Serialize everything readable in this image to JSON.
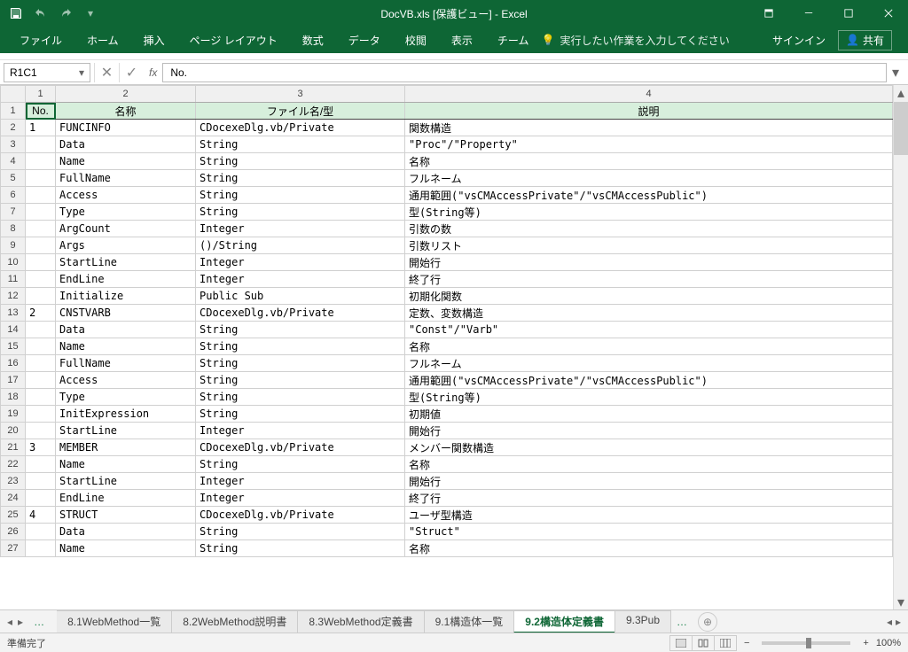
{
  "title": "DocVB.xls [保護ビュー] - Excel",
  "qat": {
    "save": "save",
    "undo": "undo",
    "redo": "redo"
  },
  "ribbon": {
    "tabs": [
      "ファイル",
      "ホーム",
      "挿入",
      "ページ レイアウト",
      "数式",
      "データ",
      "校閲",
      "表示",
      "チーム"
    ],
    "tell_me": "実行したい作業を入力してください",
    "signin": "サインイン",
    "share": "共有"
  },
  "formula_bar": {
    "name_box": "R1C1",
    "formula": "No."
  },
  "columns": {
    "numbers": [
      "1",
      "2",
      "3",
      "4"
    ]
  },
  "header_row": [
    "No.",
    "名称",
    "ファイル名/型",
    "説明"
  ],
  "rows": [
    {
      "r": 1,
      "h": true
    },
    {
      "r": 2,
      "no": "1",
      "name": "FUNCINFO",
      "file": "CDocexeDlg.vb/Private",
      "desc": "関数構造",
      "top": true
    },
    {
      "r": 3,
      "name": "Data",
      "file": "String",
      "desc": "\"Proc\"/\"Property\""
    },
    {
      "r": 4,
      "name": "Name",
      "file": "String",
      "desc": "名称"
    },
    {
      "r": 5,
      "name": "FullName",
      "file": "String",
      "desc": "フルネーム"
    },
    {
      "r": 6,
      "name": "Access",
      "file": "String",
      "desc": "通用範囲(\"vsCMAccessPrivate\"/\"vsCMAccessPublic\")"
    },
    {
      "r": 7,
      "name": "Type",
      "file": "String",
      "desc": "型(String等)"
    },
    {
      "r": 8,
      "name": "ArgCount",
      "file": "Integer",
      "desc": "引数の数"
    },
    {
      "r": 9,
      "name": "Args",
      "file": "()/String",
      "desc": "引数リスト"
    },
    {
      "r": 10,
      "name": "StartLine",
      "file": "Integer",
      "desc": "開始行"
    },
    {
      "r": 11,
      "name": "EndLine",
      "file": "Integer",
      "desc": "終了行"
    },
    {
      "r": 12,
      "name": "Initialize",
      "file": "Public Sub",
      "desc": "初期化関数"
    },
    {
      "r": 13,
      "no": "2",
      "name": "CNSTVARB",
      "file": "CDocexeDlg.vb/Private",
      "desc": "定数、変数構造",
      "top": true
    },
    {
      "r": 14,
      "name": "Data",
      "file": "String",
      "desc": "\"Const\"/\"Varb\""
    },
    {
      "r": 15,
      "name": "Name",
      "file": "String",
      "desc": "名称"
    },
    {
      "r": 16,
      "name": "FullName",
      "file": "String",
      "desc": "フルネーム"
    },
    {
      "r": 17,
      "name": "Access",
      "file": "String",
      "desc": "通用範囲(\"vsCMAccessPrivate\"/\"vsCMAccessPublic\")"
    },
    {
      "r": 18,
      "name": "Type",
      "file": "String",
      "desc": "型(String等)"
    },
    {
      "r": 19,
      "name": "InitExpression",
      "file": "String",
      "desc": "初期値"
    },
    {
      "r": 20,
      "name": "StartLine",
      "file": "Integer",
      "desc": "開始行"
    },
    {
      "r": 21,
      "no": "3",
      "name": "MEMBER",
      "file": "CDocexeDlg.vb/Private",
      "desc": "メンバー関数構造",
      "top": true
    },
    {
      "r": 22,
      "name": "Name",
      "file": "String",
      "desc": "名称"
    },
    {
      "r": 23,
      "name": "StartLine",
      "file": "Integer",
      "desc": "開始行"
    },
    {
      "r": 24,
      "name": "EndLine",
      "file": "Integer",
      "desc": "終了行"
    },
    {
      "r": 25,
      "no": "4",
      "name": "STRUCT",
      "file": "CDocexeDlg.vb/Private",
      "desc": "ユーザ型構造",
      "top": true
    },
    {
      "r": 26,
      "name": "Data",
      "file": "String",
      "desc": "\"Struct\""
    },
    {
      "r": 27,
      "name": "Name",
      "file": "String",
      "desc": "名称"
    }
  ],
  "sheet_tabs": {
    "visible": [
      "8.1WebMethod一覧",
      "8.2WebMethod説明書",
      "8.3WebMethod定義書",
      "9.1構造体一覧",
      "9.2構造体定義書",
      "9.3Pub"
    ],
    "active": "9.2構造体定義書",
    "ellipsis_left": "…",
    "ellipsis_right": "…"
  },
  "status": {
    "ready": "準備完了",
    "zoom": "100%"
  }
}
